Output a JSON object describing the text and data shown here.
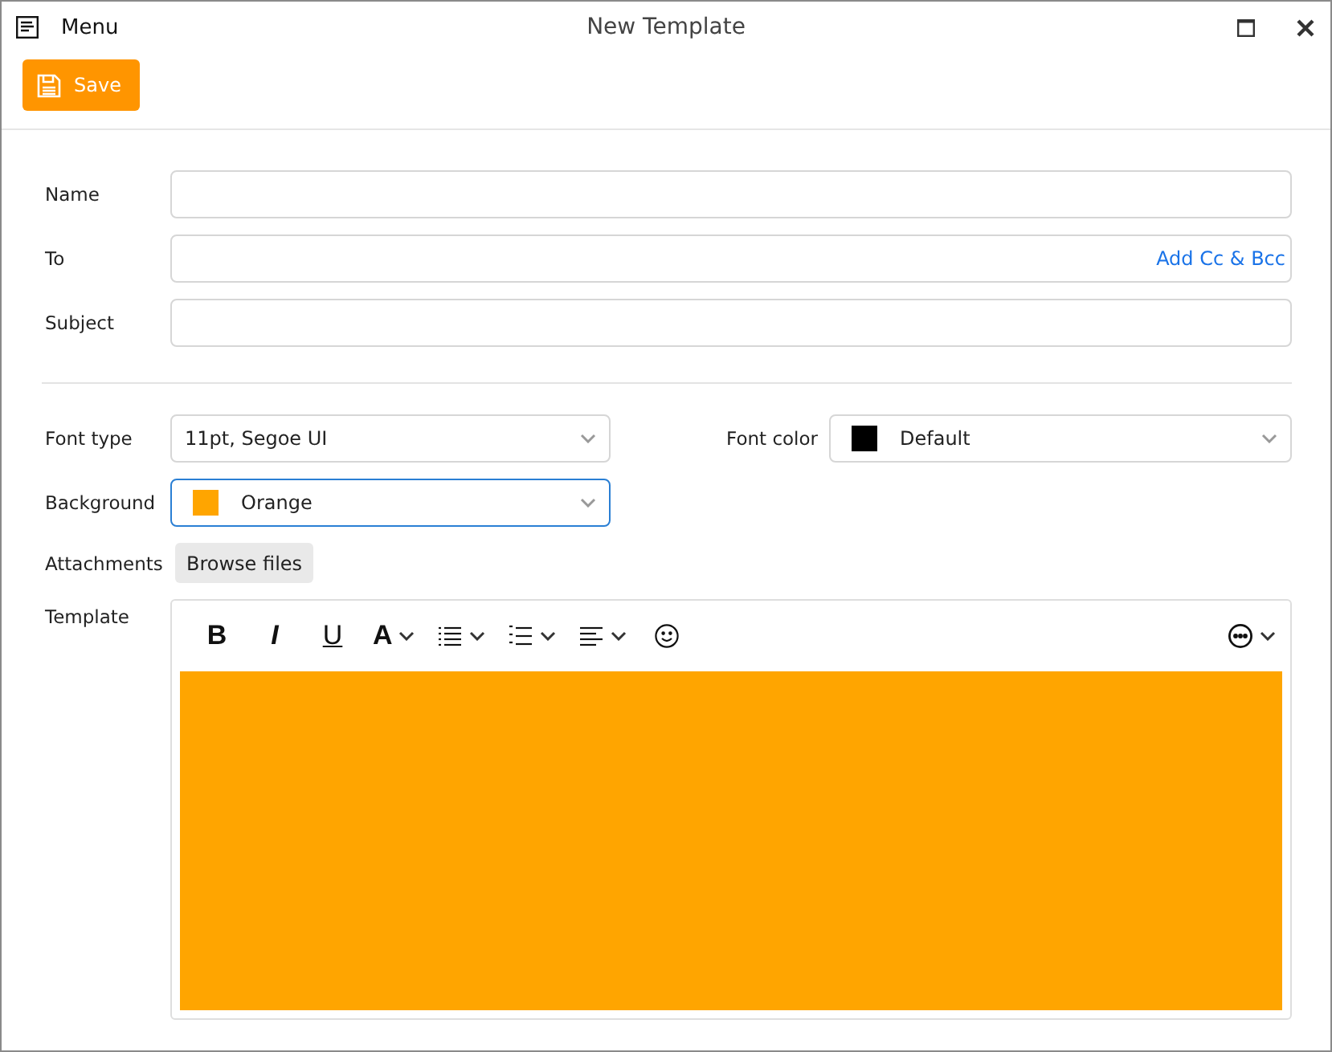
{
  "window": {
    "menu": "Menu",
    "title": "New Template"
  },
  "toolbar": {
    "save": "Save"
  },
  "fields": [
    {
      "label": "Name"
    },
    {
      "label": "To",
      "link": "Add Cc & Bcc"
    },
    {
      "label": "Subject"
    }
  ],
  "font_type": {
    "label": "Font type",
    "value": "11pt, Segoe UI",
    "focused": false
  },
  "font_color": {
    "label": "Font color",
    "value": "Default",
    "color": "#000000",
    "focused": false
  },
  "background": {
    "label": "Background",
    "value": "Orange",
    "color": "#ffa500",
    "focused": true
  },
  "attachments": {
    "label": "Attachments",
    "button": "Browse files"
  },
  "template": {
    "label": "Template",
    "tools": [
      {
        "kind": "bold",
        "label": "B",
        "dropdown": false
      },
      {
        "kind": "italic",
        "label": "I",
        "dropdown": false
      },
      {
        "kind": "underline",
        "label": "U",
        "dropdown": false
      },
      {
        "kind": "font",
        "label": "A",
        "dropdown": true
      },
      {
        "kind": "bullets",
        "dropdown": true
      },
      {
        "kind": "numbering",
        "dropdown": true
      },
      {
        "kind": "align",
        "dropdown": true
      },
      {
        "kind": "emoji",
        "dropdown": false
      },
      {
        "kind": "more",
        "dropdown": true
      }
    ]
  }
}
